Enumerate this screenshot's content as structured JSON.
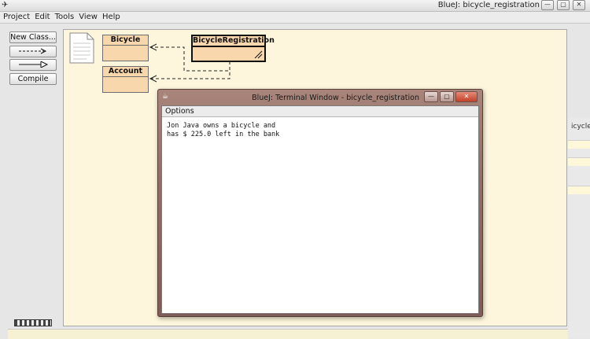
{
  "window": {
    "title": "BlueJ:  bicycle_registration"
  },
  "menu": [
    "Project",
    "Edit",
    "Tools",
    "View",
    "Help"
  ],
  "sidebar": {
    "new_class": "New Class...",
    "compile": "Compile"
  },
  "classes": [
    {
      "name": "Bicycle"
    },
    {
      "name": "BicycleRegistration"
    },
    {
      "name": "Account"
    }
  ],
  "background_window": {
    "label": "icycle"
  },
  "terminal": {
    "title": "BlueJ: Terminal Window - bicycle_registration",
    "menu": "Options",
    "lines": [
      "Jon Java owns a bicycle and",
      "has $ 225.0 left in the bank"
    ]
  }
}
